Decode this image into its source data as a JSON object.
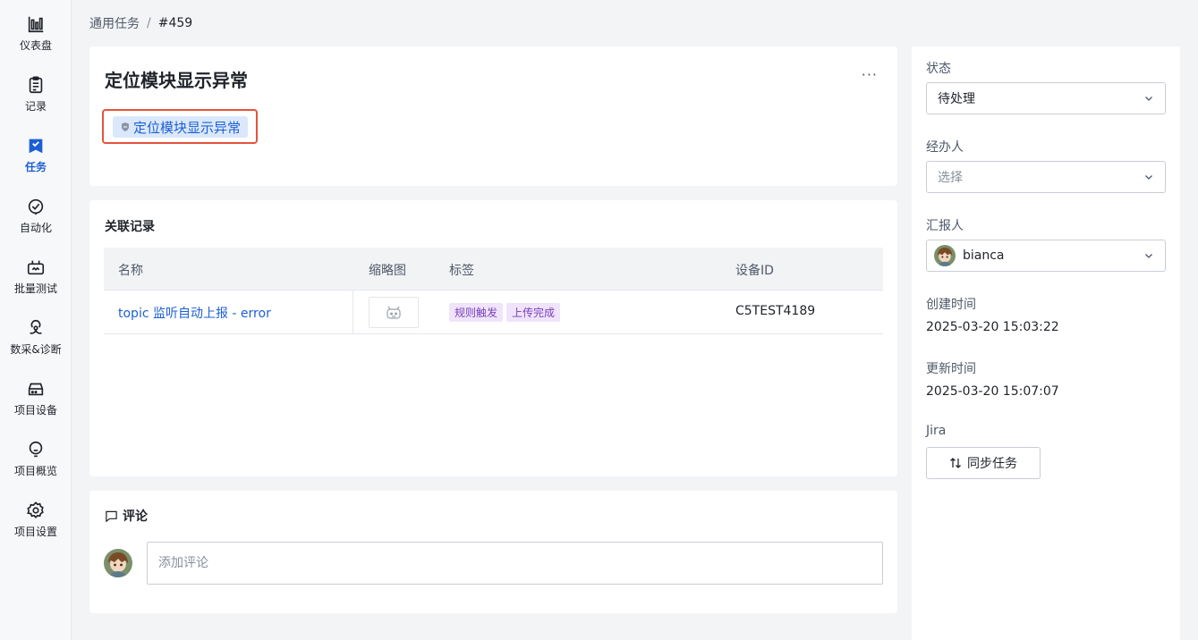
{
  "sidebar": {
    "items": [
      {
        "label": "仪表盘",
        "icon": "bar-chart-icon"
      },
      {
        "label": "记录",
        "icon": "clipboard-icon"
      },
      {
        "label": "任务",
        "icon": "task-icon",
        "active": true
      },
      {
        "label": "自动化",
        "icon": "automation-icon"
      },
      {
        "label": "批量测试",
        "icon": "batch-test-icon"
      },
      {
        "label": "数采&诊断",
        "icon": "diagnosis-icon"
      },
      {
        "label": "项目设备",
        "icon": "device-icon"
      },
      {
        "label": "项目概览",
        "icon": "overview-icon"
      },
      {
        "label": "项目设置",
        "icon": "gear-icon"
      }
    ]
  },
  "breadcrumb": {
    "parent": "通用任务",
    "separator": "/",
    "current": "#459"
  },
  "task": {
    "title": "定位模块显示异常",
    "more": "···",
    "tag_label": "定位模块显示异常"
  },
  "records": {
    "title": "关联记录",
    "columns": {
      "name": "名称",
      "thumbnail": "缩略图",
      "tags": "标签",
      "device": "设备ID"
    },
    "rows": [
      {
        "name": "topic 监听自动上报 - error",
        "tags": [
          "规则触发",
          "上传完成"
        ],
        "device": "C5TEST4189"
      }
    ]
  },
  "comments": {
    "title": "评论",
    "placeholder": "添加评论"
  },
  "details": {
    "status_label": "状态",
    "status_value": "待处理",
    "assignee_label": "经办人",
    "assignee_placeholder": "选择",
    "reporter_label": "汇报人",
    "reporter_value": "bianca",
    "created_label": "创建时间",
    "created_value": "2025-03-20 15:03:22",
    "updated_label": "更新时间",
    "updated_value": "2025-03-20 15:07:07",
    "jira_label": "Jira",
    "sync_button": "同步任务"
  },
  "colors": {
    "accent": "#1c5fd4",
    "highlight_border": "#e5533d",
    "tag_bg": "#efe4fb",
    "tag_text": "#7a3fb8"
  }
}
